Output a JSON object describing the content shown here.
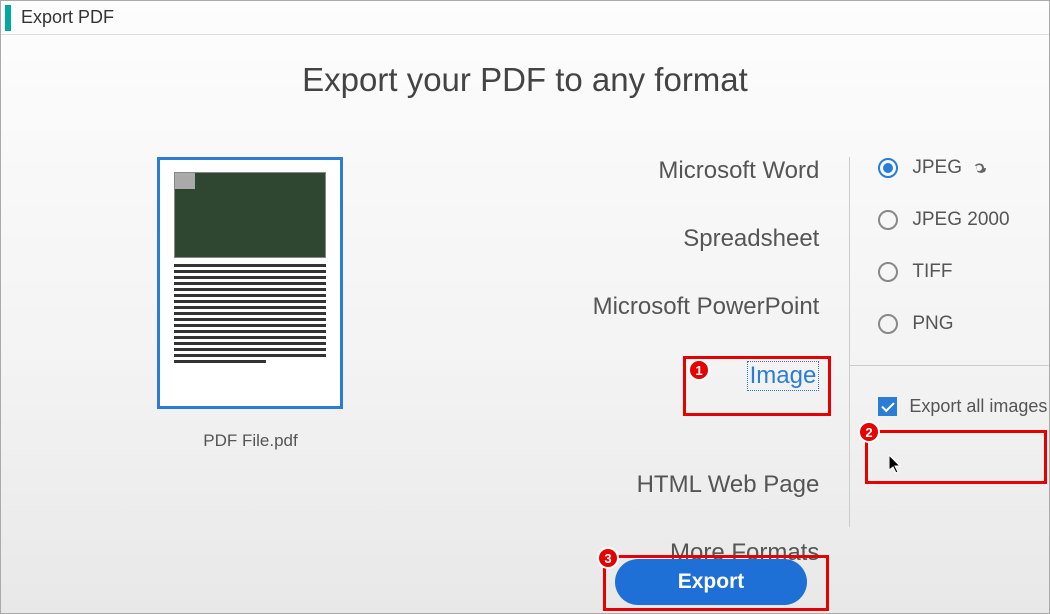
{
  "header": {
    "title": "Export PDF"
  },
  "main": {
    "title": "Export your PDF to any format"
  },
  "file": {
    "name": "PDF File.pdf"
  },
  "formats": {
    "word": "Microsoft Word",
    "spreadsheet": "Spreadsheet",
    "powerpoint": "Microsoft PowerPoint",
    "image": "Image",
    "html": "HTML Web Page",
    "more": "More Formats"
  },
  "imageOptions": {
    "jpeg": "JPEG",
    "jpeg2000": "JPEG 2000",
    "tiff": "TIFF",
    "png": "PNG",
    "exportAll": "Export all images"
  },
  "buttons": {
    "export": "Export"
  },
  "callouts": {
    "c1": "1",
    "c2": "2",
    "c3": "3"
  }
}
